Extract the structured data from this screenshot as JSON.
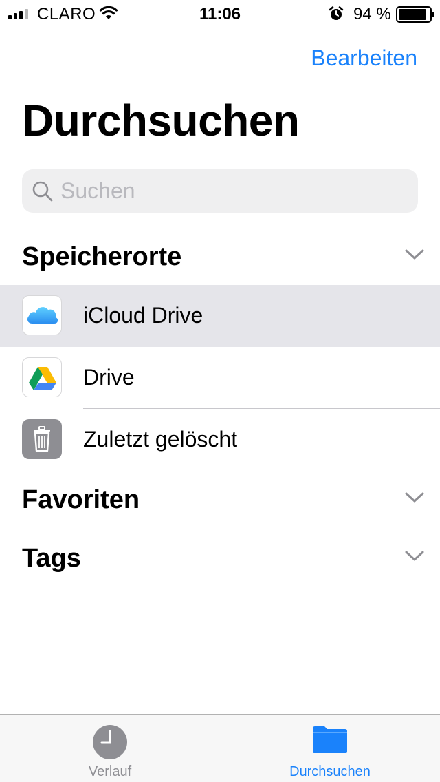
{
  "status_bar": {
    "carrier": "CLARO",
    "time": "11:06",
    "battery_percent": "94 %",
    "battery_level": 0.94,
    "signal_bars_active": 3,
    "signal_bars_total": 4
  },
  "nav": {
    "edit_label": "Bearbeiten"
  },
  "title": "Durchsuchen",
  "search": {
    "placeholder": "Suchen"
  },
  "sections": {
    "locations": {
      "title": "Speicherorte",
      "items": [
        {
          "label": "iCloud Drive",
          "icon": "icloud-icon"
        },
        {
          "label": "Drive",
          "icon": "google-drive-icon"
        },
        {
          "label": "Zuletzt gelöscht",
          "icon": "trash-icon"
        }
      ]
    },
    "favorites": {
      "title": "Favoriten"
    },
    "tags": {
      "title": "Tags"
    }
  },
  "tab_bar": {
    "tabs": [
      {
        "label": "Verlauf",
        "icon": "clock-icon",
        "active": false
      },
      {
        "label": "Durchsuchen",
        "icon": "folder-icon",
        "active": true
      }
    ]
  },
  "colors": {
    "accent": "#1a82fb",
    "selected_row": "#e5e5ea",
    "search_background": "#efeff0",
    "tab_inactive": "#8e8e93"
  }
}
